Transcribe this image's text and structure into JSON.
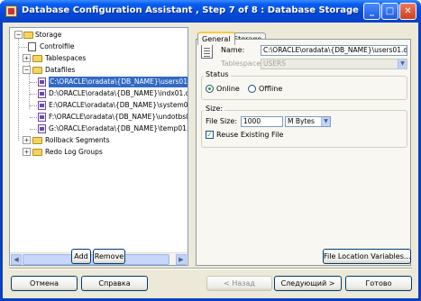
{
  "window": {
    "title": "Database Configuration Assistant , Step 7 of 8 : Database Storage",
    "controls": {
      "minimize": "_",
      "maximize": "□",
      "close": "✕"
    }
  },
  "tree": {
    "root": "Storage",
    "controlfile": "Controlfile",
    "tablespaces": "Tablespaces",
    "datafiles": "Datafiles",
    "datafile_items": [
      "C:\\ORACLE\\oradata\\{DB_NAME}\\users01.dbf",
      "D:\\ORACLE\\oradata\\{DB_NAME}\\indx01.dbf",
      "E:\\ORACLE\\oradata\\{DB_NAME}\\system01.dbf",
      "F:\\ORACLE\\oradata\\{DB_NAME}\\undotbs01.dbf",
      "G:\\ORACLE\\oradata\\{DB_NAME}\\temp01.dbf"
    ],
    "rollback": "Rollback Segments",
    "redolog": "Redo Log Groups",
    "expand_plus": "+",
    "expand_minus": "−"
  },
  "tree_buttons": {
    "add": "Add",
    "remove": "Remove"
  },
  "tabs": {
    "general": "General",
    "storage": "Storage"
  },
  "general": {
    "name_label": "Name:",
    "name_value": "C:\\ORACLE\\oradata\\{DB_NAME}\\users01.dbf",
    "tablespace_label": "Tablespace:",
    "tablespace_value": "USERS",
    "status_title": "Status",
    "online_label": "Online",
    "offline_label": "Offline",
    "size_title": "Size:",
    "filesize_label": "File Size:",
    "filesize_value": "1000",
    "unit_value": "M Bytes",
    "reuse_label": "Reuse Existing File",
    "reuse_checked": true,
    "status_selected": "Online"
  },
  "file_location_button": "File Location Variables...",
  "footer": {
    "cancel": "Отмена",
    "help": "Справка",
    "back": "Назад",
    "next": "Следующий",
    "finish": "Готово"
  },
  "colors": {
    "title_bar": "#0549d8",
    "selection": "#316ac5",
    "dialog_bg": "#ece9d8"
  }
}
